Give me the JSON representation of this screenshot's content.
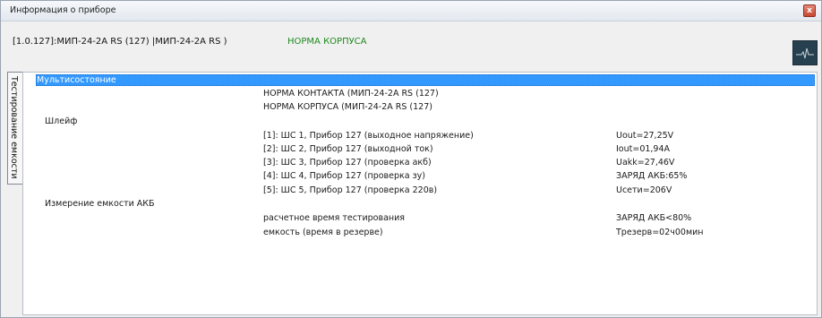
{
  "window": {
    "title": "Информация о приборе",
    "close_glyph": "x"
  },
  "header": {
    "device_id": "[1.0.127]:МИП-24-2А RS (127) |МИП-24-2А RS )",
    "case_status": "НОРМА КОРПУСА",
    "case_status_color": "#1e8a1e",
    "action_icon": "pulse-icon"
  },
  "side_tab": {
    "label": "Тестирование емкости"
  },
  "multistate": {
    "header": "Мультисостояние",
    "header_color": "#3399ff",
    "lines": [
      "НОРМА КОНТАКТА (МИП-24-2А RS (127)",
      "НОРМА КОРПУСА (МИП-24-2А RS (127)"
    ]
  },
  "loop": {
    "label": "Шлейф",
    "rows": [
      {
        "desc": "[1]: ШС 1, Прибор 127 (выходное напряжение)",
        "value": "Uout=27,25V"
      },
      {
        "desc": "[2]: ШС 2, Прибор 127 (выходной ток)",
        "value": "Iout=01,94A"
      },
      {
        "desc": "[3]: ШС 3, Прибор 127 (проверка акб)",
        "value": "Uakk=27,46V"
      },
      {
        "desc": "[4]: ШС 4, Прибор 127 (проверка зу)",
        "value": "ЗАРЯД АКБ:65%"
      },
      {
        "desc": "[5]: ШС 5, Прибор 127 (проверка 220в)",
        "value": "Uсети=206V"
      }
    ]
  },
  "capacity": {
    "label": "Измерение емкости АКБ",
    "rows": [
      {
        "desc": "расчетное время тестирования",
        "value": "ЗАРЯД АКБ<80%"
      },
      {
        "desc": "емкость (время в резерве)",
        "value": "Tрезерв=02ч00мин"
      }
    ]
  }
}
